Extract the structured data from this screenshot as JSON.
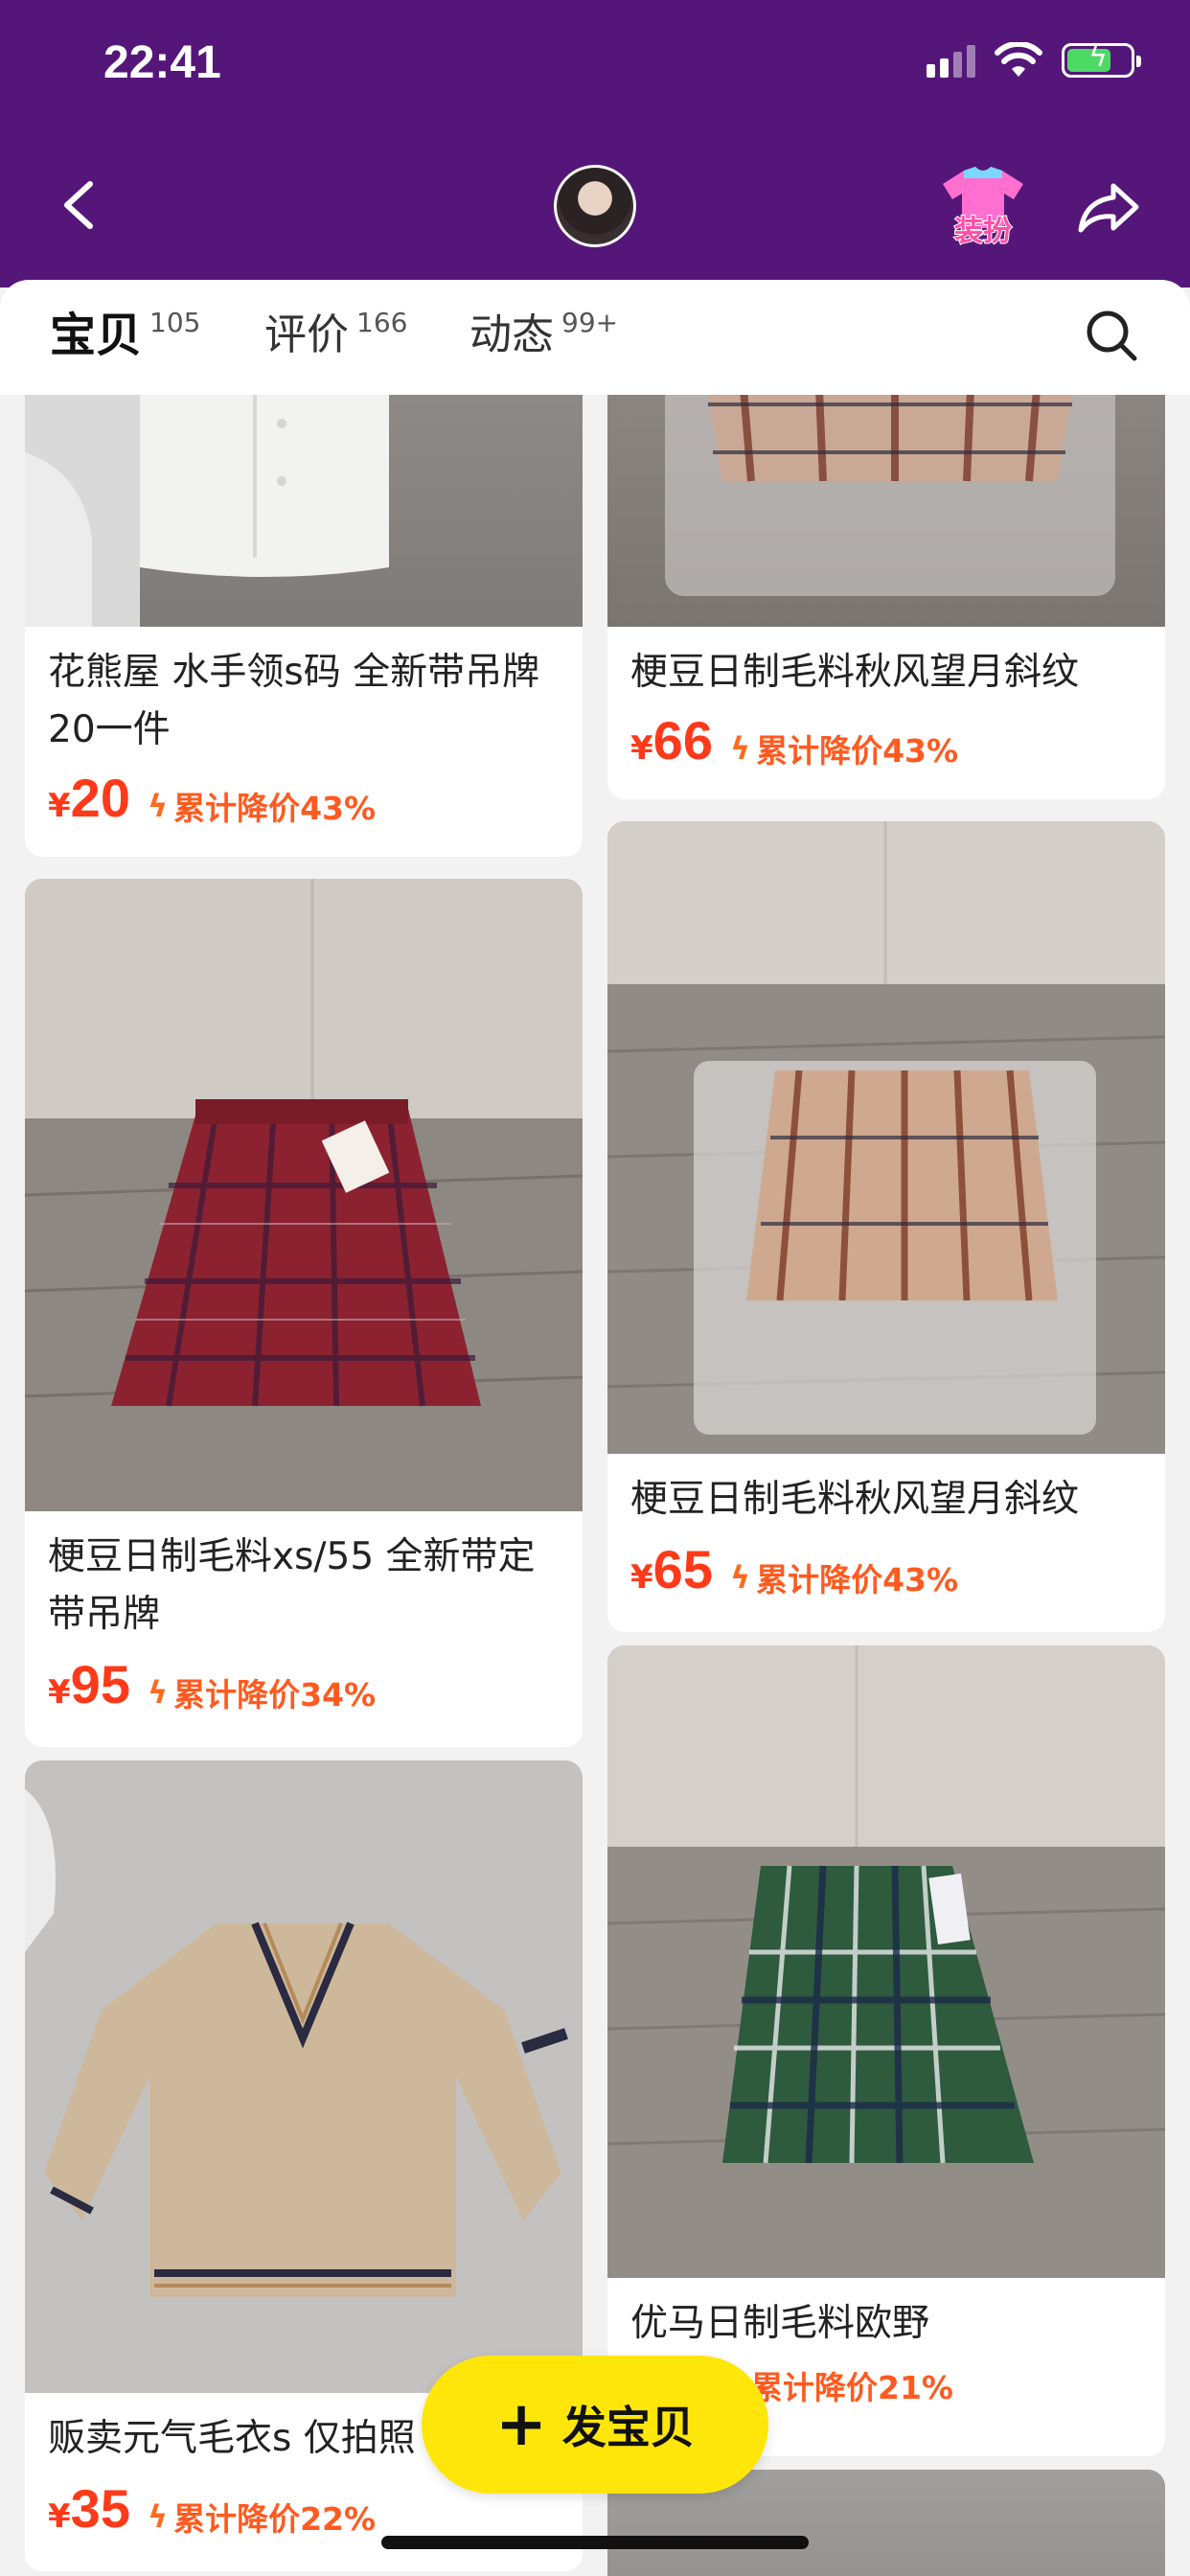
{
  "status_bar": {
    "time": "22:41"
  },
  "header": {
    "dress_label": "装扮"
  },
  "tabs": [
    {
      "label": "宝贝",
      "count": "105"
    },
    {
      "label": "评价",
      "count": "166"
    },
    {
      "label": "动态",
      "count": "99+"
    }
  ],
  "items": [
    {
      "title": "花熊屋 水手领s码 全新带吊牌20一件",
      "price": "20",
      "currency": "¥",
      "drop": "累计降价43%"
    },
    {
      "title": "梗豆日制毛料秋风望月斜纹",
      "price": "66",
      "currency": "¥",
      "drop": "累计降价43%"
    },
    {
      "title": "梗豆日制毛料xs/55 全新带定带吊牌",
      "price": "95",
      "currency": "¥",
      "drop": "累计降价34%"
    },
    {
      "title": "梗豆日制毛料秋风望月斜纹",
      "price": "65",
      "currency": "¥",
      "drop": "累计降价43%"
    },
    {
      "title": "贩卖元气毛衣s 仅拍照",
      "price": "35",
      "currency": "¥",
      "drop": "累计降价22%"
    },
    {
      "title": "优马日制毛料欧野",
      "price": "",
      "currency": "",
      "drop": "累计降价21%"
    }
  ],
  "publish_button": {
    "label": "发宝贝"
  },
  "colors": {
    "header_bg": "#551679",
    "accent_yellow": "#ffe60a",
    "price_red": "#ff3a1a"
  }
}
